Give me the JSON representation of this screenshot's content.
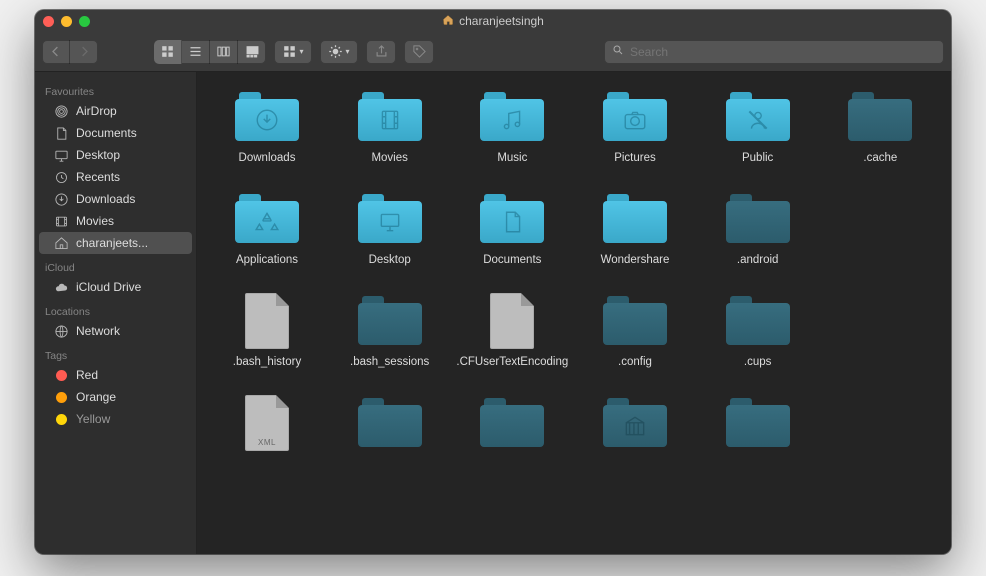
{
  "title": "charanjeetsingh",
  "search": {
    "placeholder": "Search"
  },
  "sidebar": {
    "sections": [
      {
        "heading": "Favourites",
        "items": [
          {
            "label": "AirDrop",
            "icon": "airdrop"
          },
          {
            "label": "Documents",
            "icon": "documents"
          },
          {
            "label": "Desktop",
            "icon": "desktop"
          },
          {
            "label": "Recents",
            "icon": "recents"
          },
          {
            "label": "Downloads",
            "icon": "downloads"
          },
          {
            "label": "Movies",
            "icon": "movies"
          },
          {
            "label": "charanjeets...",
            "icon": "home",
            "selected": true
          }
        ]
      },
      {
        "heading": "iCloud",
        "items": [
          {
            "label": "iCloud Drive",
            "icon": "cloud"
          }
        ]
      },
      {
        "heading": "Locations",
        "items": [
          {
            "label": "Network",
            "icon": "network"
          }
        ]
      },
      {
        "heading": "Tags",
        "items": [
          {
            "label": "Red",
            "tag": "red"
          },
          {
            "label": "Orange",
            "tag": "orange"
          },
          {
            "label": "Yellow",
            "tag": "yellow",
            "cut": true
          }
        ]
      }
    ]
  },
  "items": [
    {
      "label": "Downloads",
      "type": "folder",
      "style": "cyan",
      "icon": "download"
    },
    {
      "label": "Movies",
      "type": "folder",
      "style": "cyan",
      "icon": "film"
    },
    {
      "label": "Music",
      "type": "folder",
      "style": "cyan",
      "icon": "music"
    },
    {
      "label": "Pictures",
      "type": "folder",
      "style": "cyan",
      "icon": "camera"
    },
    {
      "label": "Public",
      "type": "folder",
      "style": "cyan",
      "icon": "public"
    },
    {
      "label": ".cache",
      "type": "folder",
      "style": "dim"
    },
    {
      "label": "Applications",
      "type": "folder",
      "style": "cyan",
      "icon": "app"
    },
    {
      "label": "Desktop",
      "type": "folder",
      "style": "cyan",
      "icon": "desktop"
    },
    {
      "label": "Documents",
      "type": "folder",
      "style": "cyan",
      "icon": "doc"
    },
    {
      "label": "Wondershare",
      "type": "folder",
      "style": "cyan"
    },
    {
      "label": ".android",
      "type": "folder",
      "style": "dim"
    },
    {
      "label": "",
      "type": "empty"
    },
    {
      "label": ".bash_history",
      "type": "file"
    },
    {
      "label": ".bash_sessions",
      "type": "folder",
      "style": "dim"
    },
    {
      "label": ".CFUserTextEncoding",
      "type": "file"
    },
    {
      "label": ".config",
      "type": "folder",
      "style": "dim"
    },
    {
      "label": ".cups",
      "type": "folder",
      "style": "dim"
    },
    {
      "label": "",
      "type": "empty"
    },
    {
      "label": "",
      "type": "file",
      "badge": "XML"
    },
    {
      "label": "",
      "type": "folder",
      "style": "dim"
    },
    {
      "label": "",
      "type": "folder",
      "style": "dim"
    },
    {
      "label": "",
      "type": "folder",
      "style": "dim",
      "icon": "library"
    },
    {
      "label": "",
      "type": "folder",
      "style": "dim"
    },
    {
      "label": "",
      "type": "empty"
    }
  ]
}
